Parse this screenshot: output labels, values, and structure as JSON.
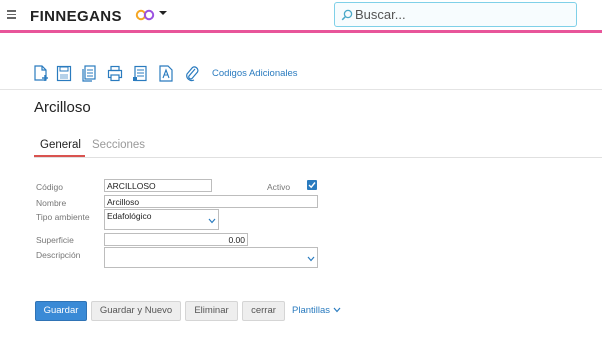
{
  "header": {
    "brand": "FINNEGANS",
    "search_placeholder": "Buscar..."
  },
  "toolbar": {
    "icons": [
      "new-document-icon",
      "save-icon",
      "copy-document-icon",
      "print-icon",
      "list-document-icon",
      "text-document-icon",
      "attachment-icon"
    ],
    "link_label": "Codigos Adicionales"
  },
  "page": {
    "title": "Arcilloso"
  },
  "tabs": [
    {
      "label": "General",
      "active": true
    },
    {
      "label": "Secciones",
      "active": false
    }
  ],
  "form": {
    "codigo_label": "Código",
    "codigo_value": "ARCILLOSO",
    "activo_label": "Activo",
    "activo_checked": true,
    "nombre_label": "Nombre",
    "nombre_value": "Arcilloso",
    "tipo_ambiente_label": "Tipo ambiente",
    "tipo_ambiente_value": "Edafológico",
    "superficie_label": "Superficie",
    "superficie_value": "0.00",
    "descripcion_label": "Descripción",
    "descripcion_value": ""
  },
  "buttons": {
    "guardar": "Guardar",
    "guardar_nuevo": "Guardar y Nuevo",
    "eliminar": "Eliminar",
    "cerrar": "cerrar",
    "plantillas": "Plantillas"
  },
  "colors": {
    "accent_pink": "#e8559a",
    "link_blue": "#2a7bbf",
    "primary_button": "#3a8ad6",
    "tab_underline": "#d9534f"
  }
}
